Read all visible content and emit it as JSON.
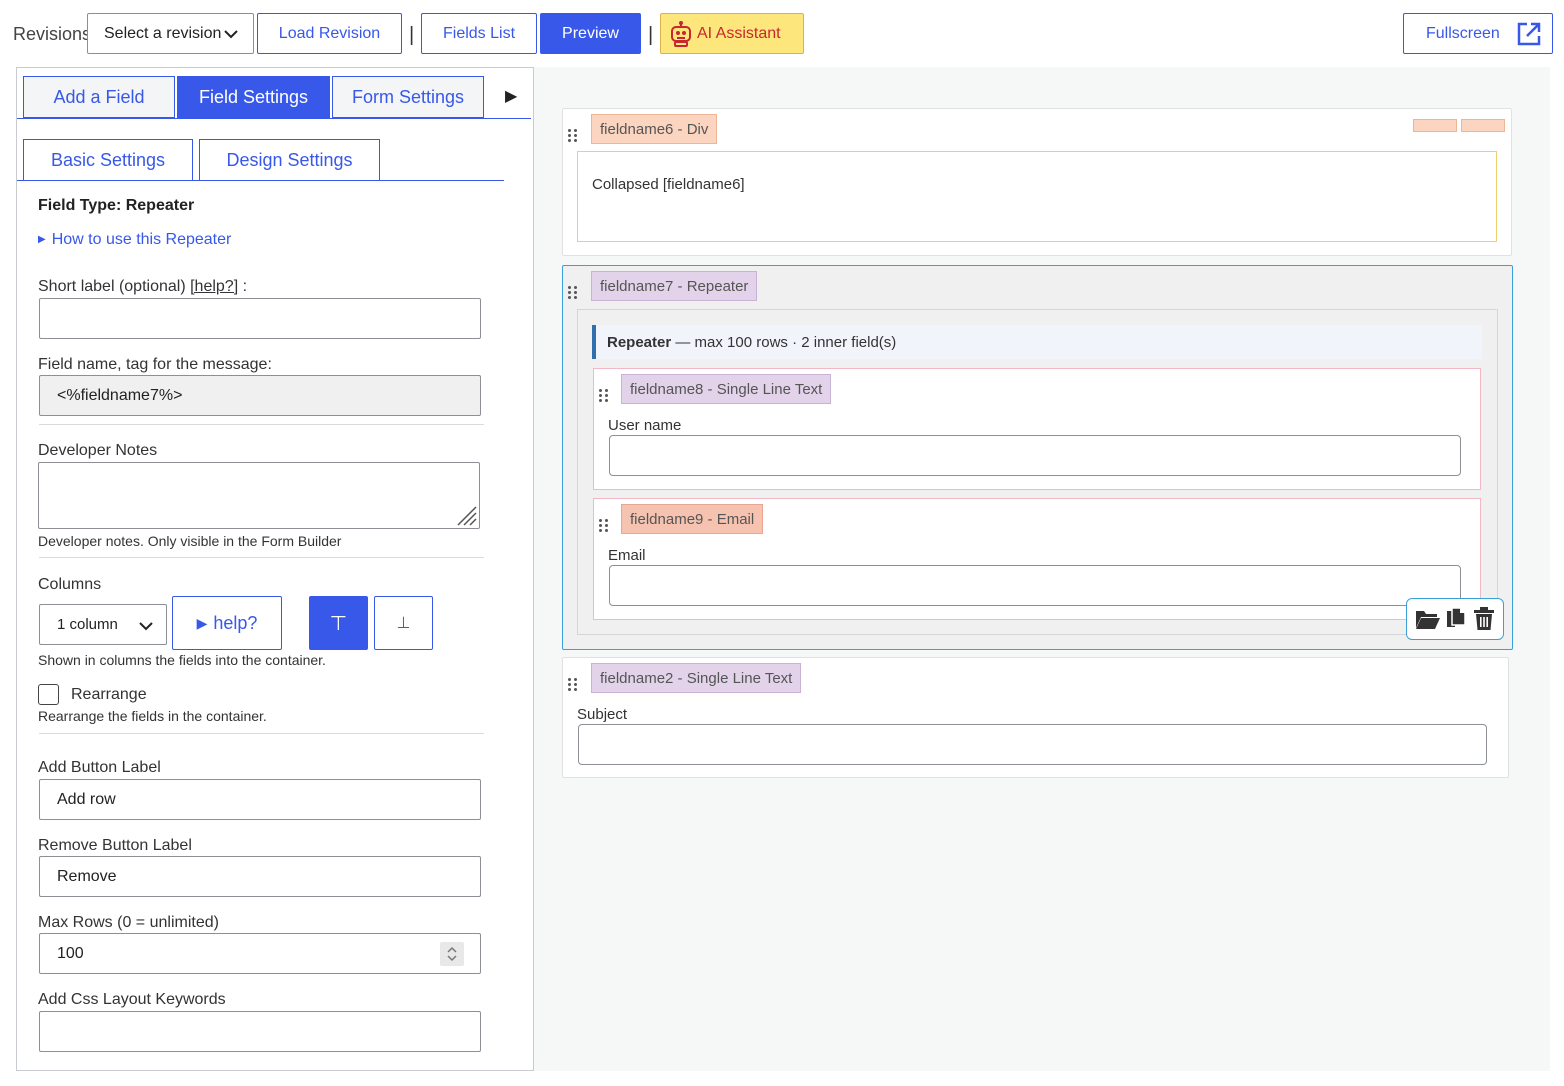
{
  "toolbar": {
    "revisions_label": "Revisions",
    "revision_select": "Select a revision",
    "load_revision": "Load Revision",
    "separator": "|",
    "fields_list": "Fields List",
    "preview": "Preview",
    "ai_assistant": "AI Assistant",
    "fullscreen": "Fullscreen"
  },
  "tabs": {
    "add_field": "Add a Field",
    "field_settings": "Field Settings",
    "form_settings": "Form Settings",
    "more_arrow": "▶"
  },
  "subtabs": {
    "basic": "Basic Settings",
    "design": "Design Settings"
  },
  "settings": {
    "field_type": "Field Type: Repeater",
    "how_to": "How to use this Repeater",
    "short_label": "Short label (optional)",
    "short_label_help": "[help?]",
    "short_label_colon": ":",
    "short_label_value": "",
    "field_name_label": "Field name, tag for the message:",
    "field_name_value": "<%fieldname7%>",
    "dev_notes_label": "Developer Notes",
    "dev_notes_value": "",
    "dev_notes_help": "Developer notes. Only visible in the Form Builder",
    "columns_label": "Columns",
    "columns_value": "1 column",
    "columns_help_btn": "help?",
    "align_top": "⊤",
    "align_bottom": "⊥",
    "columns_help": "Shown in columns the fields into the container.",
    "rearrange_label": "Rearrange",
    "rearrange_checked": false,
    "rearrange_help": "Rearrange the fields in the container.",
    "add_button_label": "Add Button Label",
    "add_button_value": "Add row",
    "remove_button_label": "Remove Button Label",
    "remove_button_value": "Remove",
    "max_rows_label": "Max Rows (0 = unlimited)",
    "max_rows_value": "100",
    "css_label": "Add Css Layout Keywords",
    "css_value": ""
  },
  "canvas": {
    "div_field": {
      "tag": "fieldname6 - Div",
      "content": "Collapsed [fieldname6]"
    },
    "repeater_field": {
      "tag": "fieldname7 - Repeater",
      "summary_bold": "Repeater",
      "summary_rest": "— max 100 rows · 2 inner field(s)",
      "inner": [
        {
          "tag": "fieldname8 - Single Line Text",
          "label": "User name"
        },
        {
          "tag": "fieldname9 - Email",
          "label": "Email"
        }
      ]
    },
    "subject_field": {
      "tag": "fieldname2 - Single Line Text",
      "label": "Subject"
    }
  },
  "colors": {
    "accent": "#3858e9",
    "ai_bg": "#fde77d",
    "ai_text": "#c6282e",
    "selected_border": "#3aa0d8"
  }
}
